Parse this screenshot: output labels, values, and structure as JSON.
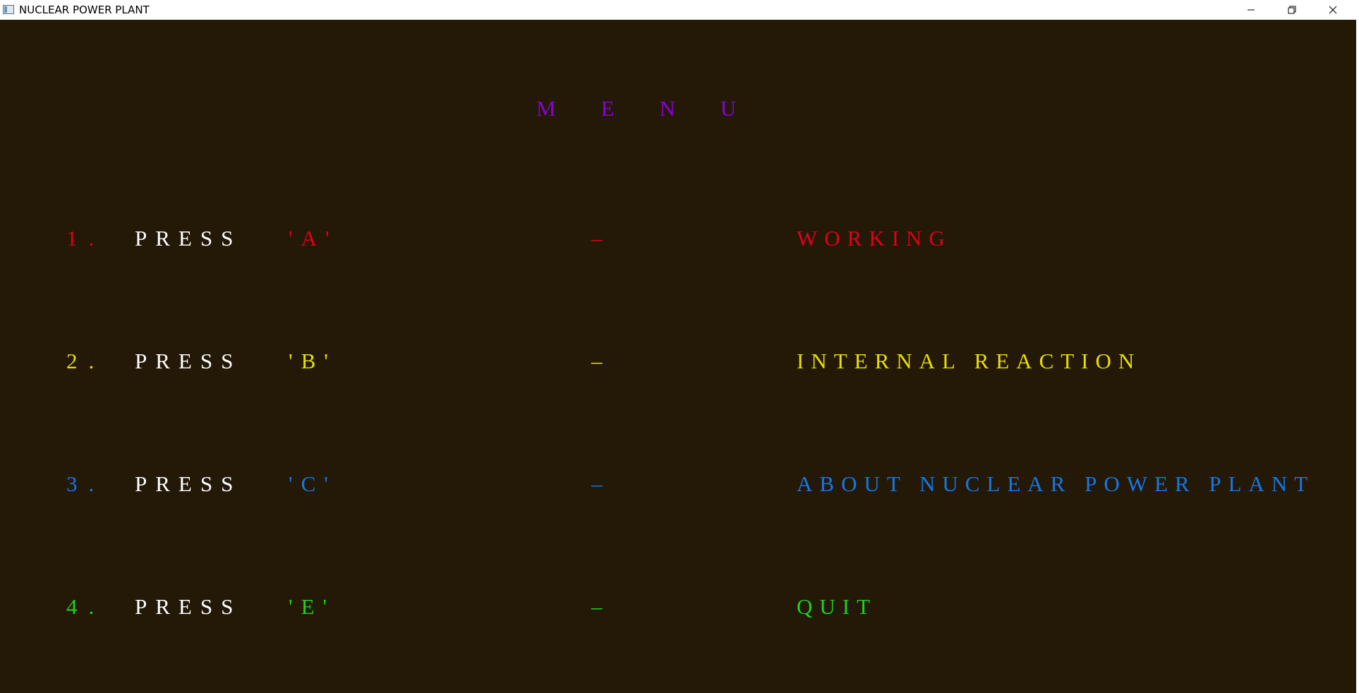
{
  "window": {
    "title": "NUCLEAR POWER PLANT",
    "icons": [
      "app-icon",
      "minimize-icon",
      "restore-icon",
      "close-icon"
    ]
  },
  "menu": {
    "title": "MENU",
    "title_color": "#8b00d6",
    "items": [
      {
        "number": "1.",
        "press": "PRESS",
        "key": "'A'",
        "dash": "–",
        "label": "WORKING",
        "color": "#e0001a"
      },
      {
        "number": "2.",
        "press": "PRESS",
        "key": "'B'",
        "dash": "–",
        "label": "INTERNAL REACTION",
        "color": "#e6e000"
      },
      {
        "number": "3.",
        "press": "PRESS",
        "key": "'C'",
        "dash": "–",
        "label": "ABOUT NUCLEAR POWER PLANT",
        "color": "#1478e6"
      },
      {
        "number": "4.",
        "press": "PRESS",
        "key": "'E'",
        "dash": "–",
        "label": "QUIT",
        "color": "#1ed21e"
      }
    ]
  },
  "colors": {
    "background": "#241807",
    "press_text": "#ffffff"
  }
}
